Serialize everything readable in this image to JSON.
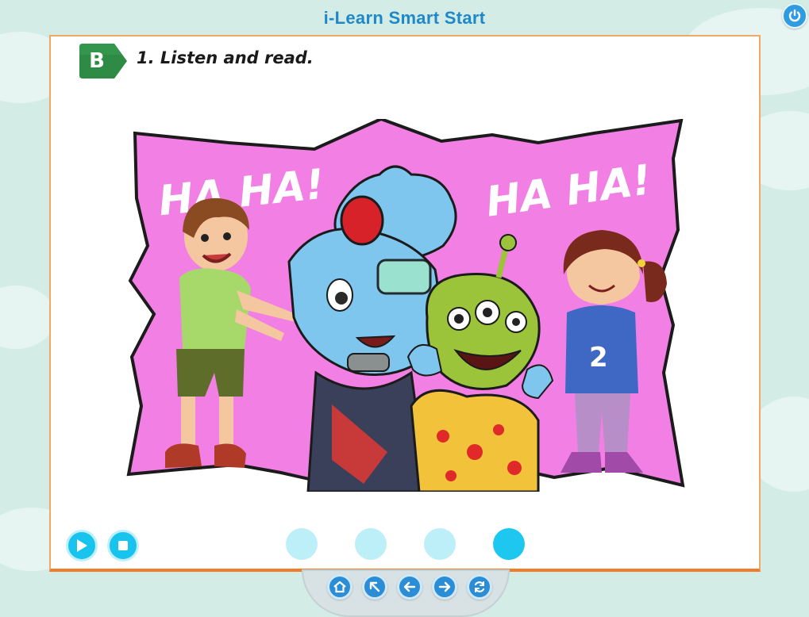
{
  "app": {
    "title": "i-Learn Smart Start"
  },
  "section": {
    "letter": "B",
    "instruction": "1. Listen and read."
  },
  "illustration": {
    "speech_left": "HA HA!",
    "speech_right": "HA HA!",
    "shirt_number": "2"
  },
  "audio_controls": [
    "play-icon",
    "stop-icon"
  ],
  "pagination": {
    "total": 4,
    "current": 4
  },
  "navigation": [
    "home-icon",
    "up-left-arrow-icon",
    "back-arrow-icon",
    "forward-arrow-icon",
    "refresh-icon"
  ],
  "colors": {
    "accent": "#1ec7f0",
    "panel_border": "#f07c2a",
    "badge_green": "#2e8b45",
    "title_blue": "#1f88c8",
    "comic_pink": "#f27fe3"
  }
}
